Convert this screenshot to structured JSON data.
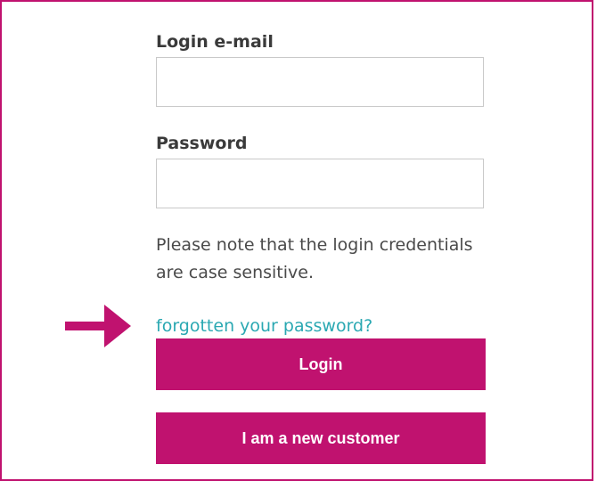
{
  "login_form": {
    "email_label": "Login e-mail",
    "email_value": "",
    "email_placeholder": "",
    "password_label": "Password",
    "password_value": "",
    "password_placeholder": "",
    "note": "Please note that the login credentials are case sensitive.",
    "forgot_link": "forgotten your password?",
    "login_button": "Login",
    "new_customer_button": "I am a new customer"
  },
  "annotation": {
    "icon": "arrow-right-icon"
  },
  "colors": {
    "brand": "#c0126f",
    "link": "#2aa8b2",
    "text": "#3a3a3a",
    "input_border": "#c9c9c9"
  }
}
